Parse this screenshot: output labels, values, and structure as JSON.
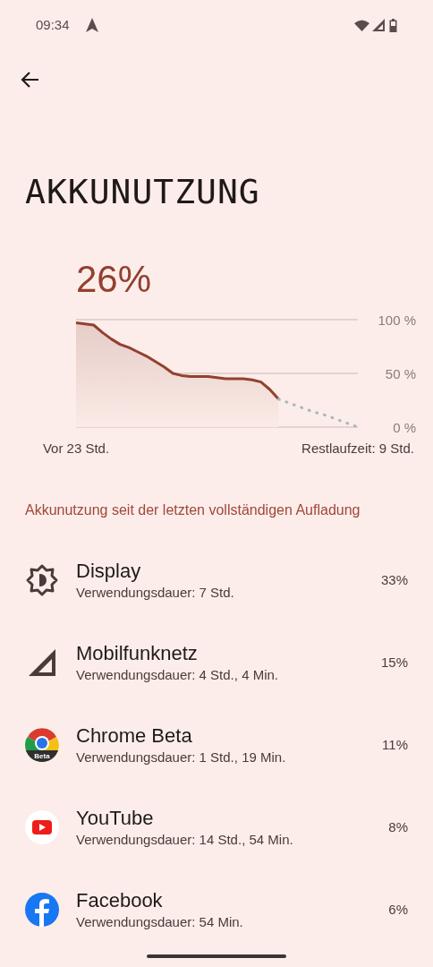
{
  "status_bar": {
    "time": "09:34"
  },
  "title": "AKKUNUTZUNG",
  "battery_level": "26%",
  "chart_data": {
    "type": "area",
    "categories": [
      "Vor 23 Std.",
      null,
      null,
      null,
      null,
      null,
      null,
      null,
      null,
      null,
      null,
      null,
      null,
      null,
      null,
      null,
      null,
      null,
      null,
      null,
      null,
      null,
      null,
      null,
      null,
      null,
      null,
      null,
      null,
      null,
      null,
      null,
      "Restlaufzeit: 9 Std."
    ],
    "series": [
      {
        "color": "#93402f",
        "values": [
          97,
          96,
          95,
          88,
          82,
          77,
          74,
          70,
          66,
          61,
          56,
          50,
          48,
          47,
          47,
          47,
          46,
          45,
          45,
          45,
          44,
          42,
          35,
          26,
          null,
          null,
          null,
          null,
          null,
          null,
          null,
          null,
          null
        ]
      },
      {
        "color": "#a9b8bd",
        "type": "line",
        "line_style": "dotted",
        "values": [
          null,
          null,
          null,
          null,
          null,
          null,
          null,
          null,
          null,
          null,
          null,
          null,
          null,
          null,
          null,
          null,
          null,
          null,
          null,
          null,
          null,
          null,
          null,
          26,
          23,
          20,
          17,
          14,
          12,
          9,
          6,
          3,
          0
        ]
      }
    ],
    "ylim": [
      0,
      100
    ],
    "yticks": [
      {
        "value": 0,
        "label": "0 %"
      },
      {
        "value": 50,
        "label": "50 %"
      },
      {
        "value": 100,
        "label": "100 %"
      }
    ]
  },
  "section_title": "Akkunutzung seit der letzten vollständigen Aufladung",
  "items": [
    {
      "kind": "display",
      "name": "Display",
      "usage": "Verwendungsdauer: 7 Std.",
      "percent": "33%"
    },
    {
      "kind": "cellular",
      "name": "Mobilfunknetz",
      "usage": "Verwendungsdauer: 4 Std., 4 Min.",
      "percent": "15%"
    },
    {
      "kind": "chrome",
      "name": "Chrome Beta",
      "usage": "Verwendungsdauer: 1 Std., 19 Min.",
      "percent": "11%",
      "badge": "Beta"
    },
    {
      "kind": "youtube",
      "name": "YouTube",
      "usage": "Verwendungsdauer: 14 Std., 54 Min.",
      "percent": "8%"
    },
    {
      "kind": "facebook",
      "name": "Facebook",
      "usage": "Verwendungsdauer: 54 Min.",
      "percent": "6%"
    }
  ]
}
